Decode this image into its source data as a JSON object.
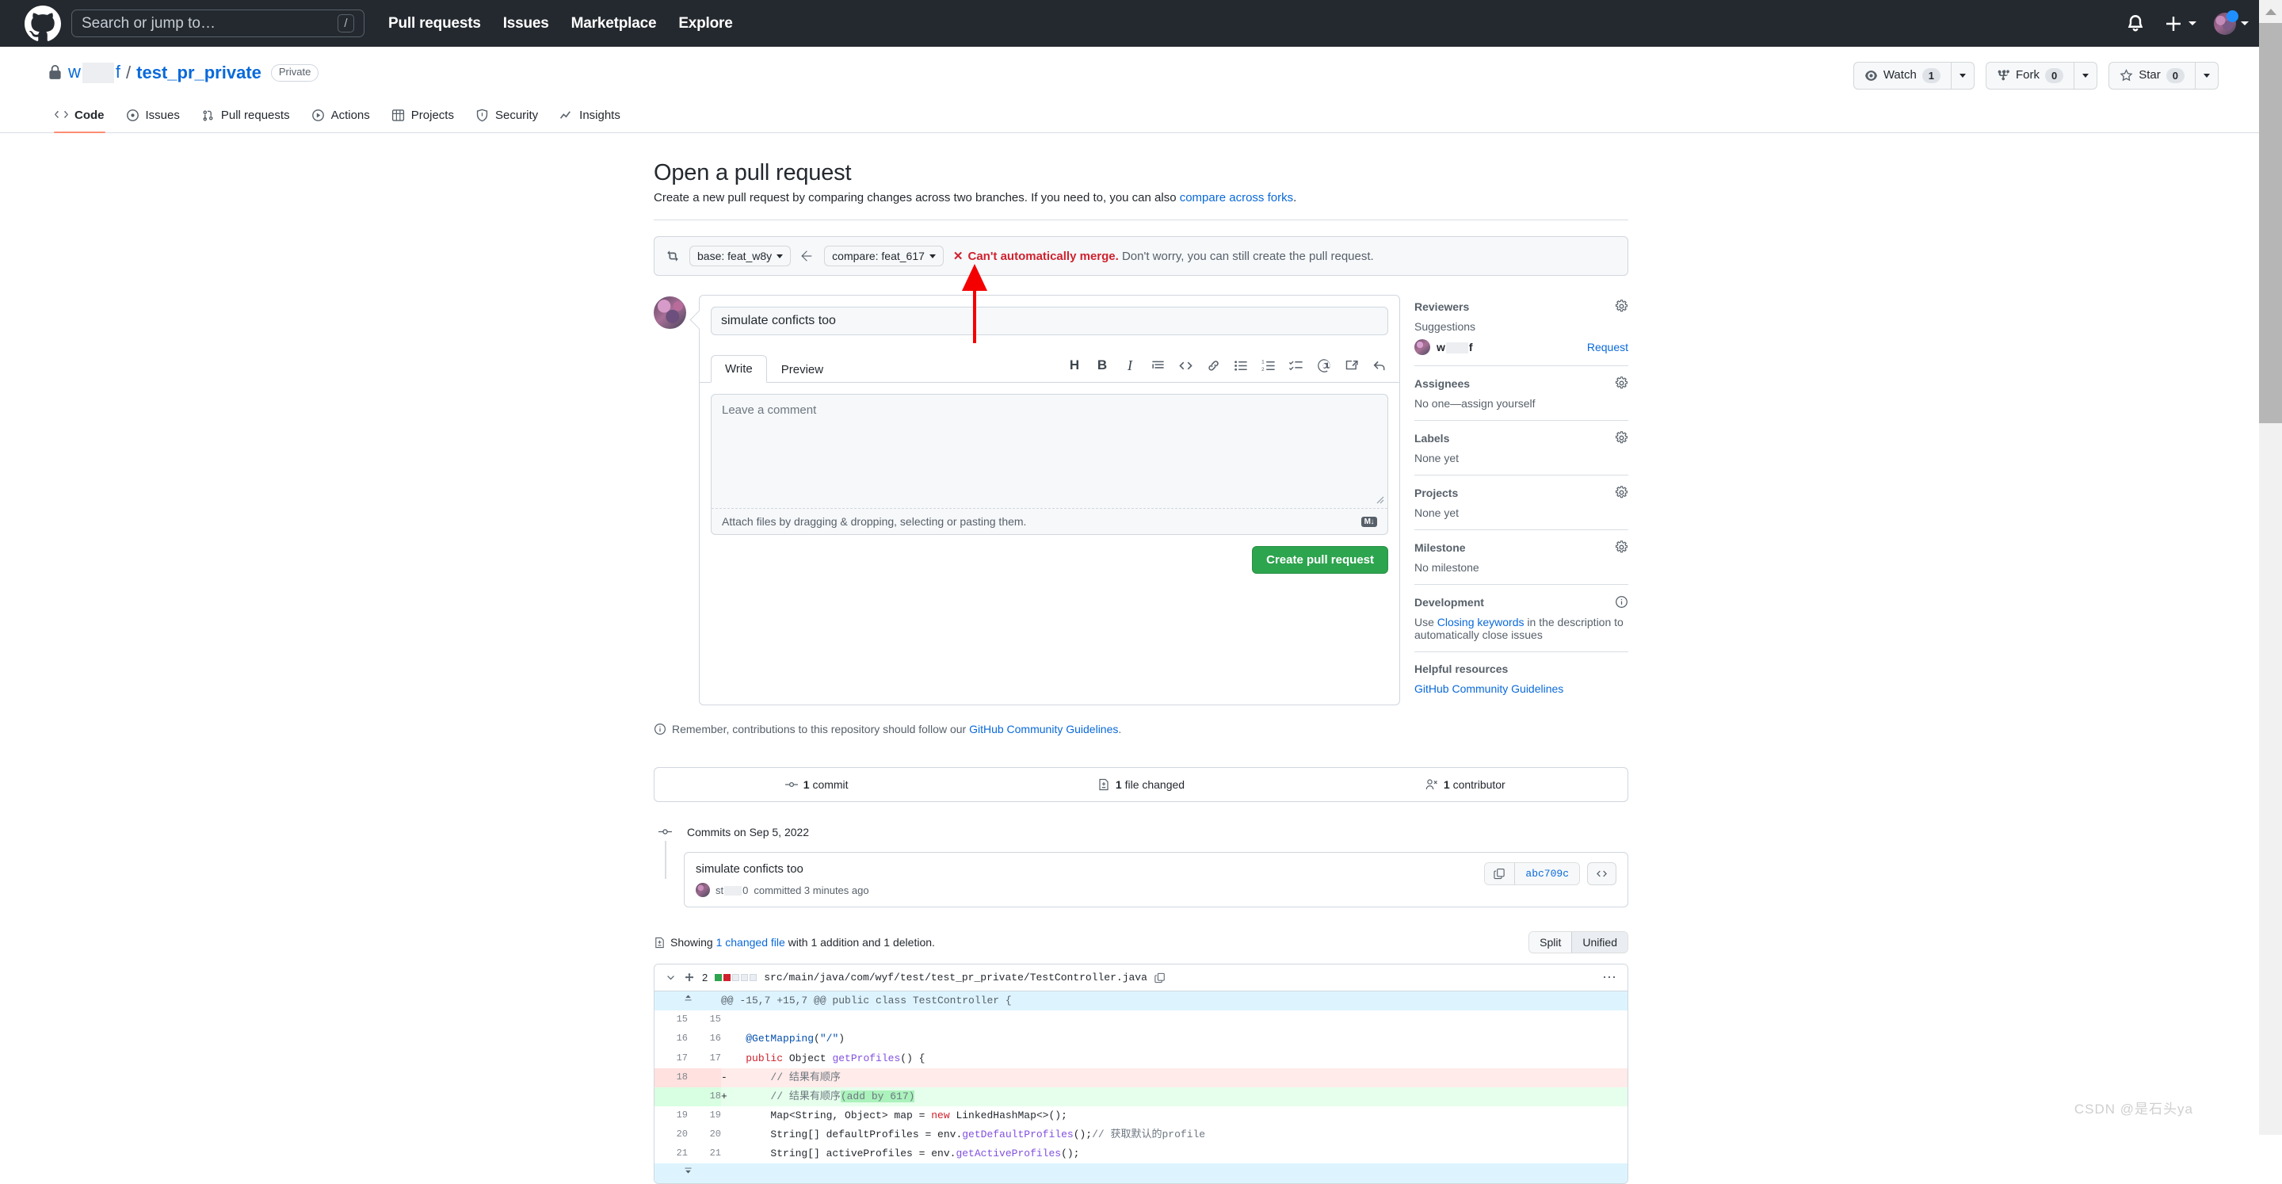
{
  "global_header": {
    "logo_icon": "github-mark-icon",
    "search": {
      "placeholder": "Search or jump to…",
      "shortcut": "/"
    },
    "nav": [
      "Pull requests",
      "Issues",
      "Marketplace",
      "Explore"
    ],
    "notifications_icon": "bell-icon",
    "create_new_icon": "plus-icon",
    "profile_icon": "avatar"
  },
  "repo_header": {
    "lock_icon": "lock-icon",
    "owner": "w",
    "owner_redacted_suffix": "f",
    "separator": "/",
    "name": "test_pr_private",
    "visibility": "Private",
    "actions": {
      "watch": {
        "label": "Watch",
        "count": "1",
        "icon": "eye-icon"
      },
      "fork": {
        "label": "Fork",
        "count": "0",
        "icon": "repo-forked-icon"
      },
      "star": {
        "label": "Star",
        "count": "0",
        "icon": "star-icon"
      }
    },
    "tabs": [
      {
        "label": "Code",
        "icon": "code-icon",
        "active": true
      },
      {
        "label": "Issues",
        "icon": "issue-opened-icon",
        "active": false
      },
      {
        "label": "Pull requests",
        "icon": "git-pull-request-icon",
        "active": false
      },
      {
        "label": "Actions",
        "icon": "play-icon",
        "active": false
      },
      {
        "label": "Projects",
        "icon": "table-icon",
        "active": false
      },
      {
        "label": "Security",
        "icon": "shield-icon",
        "active": false
      },
      {
        "label": "Insights",
        "icon": "graph-icon",
        "active": false
      }
    ]
  },
  "main": {
    "title": "Open a pull request",
    "subtitle_before": "Create a new pull request by comparing changes across two branches. If you need to, you can also ",
    "subtitle_link": "compare across forks",
    "subtitle_after": ".",
    "branch_bar": {
      "sync_icon": "git-compare-icon",
      "base_label": "base: feat_w8y",
      "arrow_icon": "arrow-left-icon",
      "compare_label": "compare: feat_617",
      "status_x": "✕",
      "status_bold": "Can't automatically merge.",
      "status_rest": " Don't worry, you can still create the pull request."
    },
    "form": {
      "title_value": "simulate conficts too",
      "title_placeholder": "Title",
      "tabs": [
        {
          "label": "Write",
          "active": true
        },
        {
          "label": "Preview",
          "active": false
        }
      ],
      "markdown_tools": [
        {
          "name": "heading-icon",
          "glyph": "H"
        },
        {
          "name": "bold-icon",
          "glyph": "B"
        },
        {
          "name": "italic-icon",
          "glyph": "I"
        },
        {
          "name": "quote-icon",
          "glyph": ""
        },
        {
          "name": "code-icon",
          "glyph": ""
        },
        {
          "name": "link-icon",
          "glyph": ""
        },
        {
          "name": "unordered-list-icon",
          "glyph": ""
        },
        {
          "name": "ordered-list-icon",
          "glyph": ""
        },
        {
          "name": "task-list-icon",
          "glyph": ""
        },
        {
          "name": "mention-icon",
          "glyph": ""
        },
        {
          "name": "reference-icon",
          "glyph": ""
        },
        {
          "name": "reply-icon",
          "glyph": ""
        }
      ],
      "comment_placeholder": "Leave a comment",
      "attach_text": "Attach files by dragging & dropping, selecting or pasting them.",
      "markdown_badge": "M↓",
      "submit_label": "Create pull request",
      "note_before": "Remember, contributions to this repository should follow our ",
      "note_link": "GitHub Community Guidelines",
      "note_after": "."
    },
    "sidebar": [
      {
        "title": "Reviewers",
        "gear_icon": "gear-icon",
        "sub": "Suggestions",
        "reviewer": {
          "name": "w",
          "name_suffix": "f",
          "action": "Request"
        }
      },
      {
        "title": "Assignees",
        "gear_icon": "gear-icon",
        "value": "No one—assign yourself"
      },
      {
        "title": "Labels",
        "gear_icon": "gear-icon",
        "value": "None yet"
      },
      {
        "title": "Projects",
        "gear_icon": "gear-icon",
        "value": "None yet"
      },
      {
        "title": "Milestone",
        "gear_icon": "gear-icon",
        "value": "No milestone"
      },
      {
        "title": "Development",
        "gear_icon": "info-icon",
        "dev_before": "Use ",
        "dev_link": "Closing keywords",
        "dev_after": " in the description to automatically close issues"
      },
      {
        "title": "Helpful resources",
        "link": "GitHub Community Guidelines"
      }
    ],
    "stats": [
      {
        "icon": "commit-icon",
        "count": "1",
        "label": "commit"
      },
      {
        "icon": "file-diff-icon",
        "count": "1",
        "label": "file changed"
      },
      {
        "icon": "people-icon",
        "count": "1",
        "label": "contributor"
      }
    ],
    "commits": {
      "group_icon": "commit-icon",
      "group_label": "Commits on Sep 5, 2022",
      "items": [
        {
          "message": "simulate conficts too",
          "author": "st",
          "author_suffix": "0",
          "meta": "committed 3 minutes ago",
          "copy_icon": "copy-icon",
          "sha": "abc709c",
          "browse_icon": "code-icon"
        }
      ]
    },
    "diff": {
      "summary_icon": "file-diff-icon",
      "summary_before": "Showing ",
      "summary_link": "1 changed file",
      "summary_after": " with 1 addition and 1 deletion.",
      "view_modes": [
        {
          "label": "Split",
          "active": false
        },
        {
          "label": "Unified",
          "active": true
        }
      ],
      "file": {
        "chevron_icon": "chevron-down-icon",
        "diffstat_icon": "diff-icon",
        "changes": "2",
        "blocks": [
          "add",
          "del",
          "none",
          "none",
          "none"
        ],
        "path": "src/main/java/com/wyf/test/test_pr_private/TestController.java",
        "copy_icon": "copy-path-icon",
        "menu_icon": "kebab-icon",
        "hunk_header": "@@ -15,7 +15,7 @@ public class TestController {",
        "lines": [
          {
            "type": "context",
            "old": "15",
            "new": "15",
            "mark": "",
            "code": ""
          },
          {
            "type": "context",
            "old": "16",
            "new": "16",
            "mark": "",
            "code": "    @GetMapping(\"/\")"
          },
          {
            "type": "context",
            "old": "17",
            "new": "17",
            "mark": "",
            "code": "    public Object getProfiles() {"
          },
          {
            "type": "del",
            "old": "18",
            "new": "",
            "mark": "-",
            "code": "        // 结果有顺序"
          },
          {
            "type": "add",
            "old": "",
            "new": "18",
            "mark": "+",
            "code": "        // 结果有顺序(add by 617)"
          },
          {
            "type": "context",
            "old": "19",
            "new": "19",
            "mark": "",
            "code": "        Map<String, Object> map = new LinkedHashMap<>();"
          },
          {
            "type": "context",
            "old": "20",
            "new": "20",
            "mark": "",
            "code": "        String[] defaultProfiles = env.getDefaultProfiles();// 获取默认的profile"
          },
          {
            "type": "context",
            "old": "21",
            "new": "21",
            "mark": "",
            "code": "        String[] activeProfiles = env.getActiveProfiles();"
          }
        ]
      }
    }
  },
  "watermark": "CSDN @是石头ya",
  "colors": {
    "accent": "#0969da",
    "danger": "#cf222e",
    "success": "#2da44e",
    "header_bg": "#24292f",
    "tab_underline": "#fd8c73"
  }
}
